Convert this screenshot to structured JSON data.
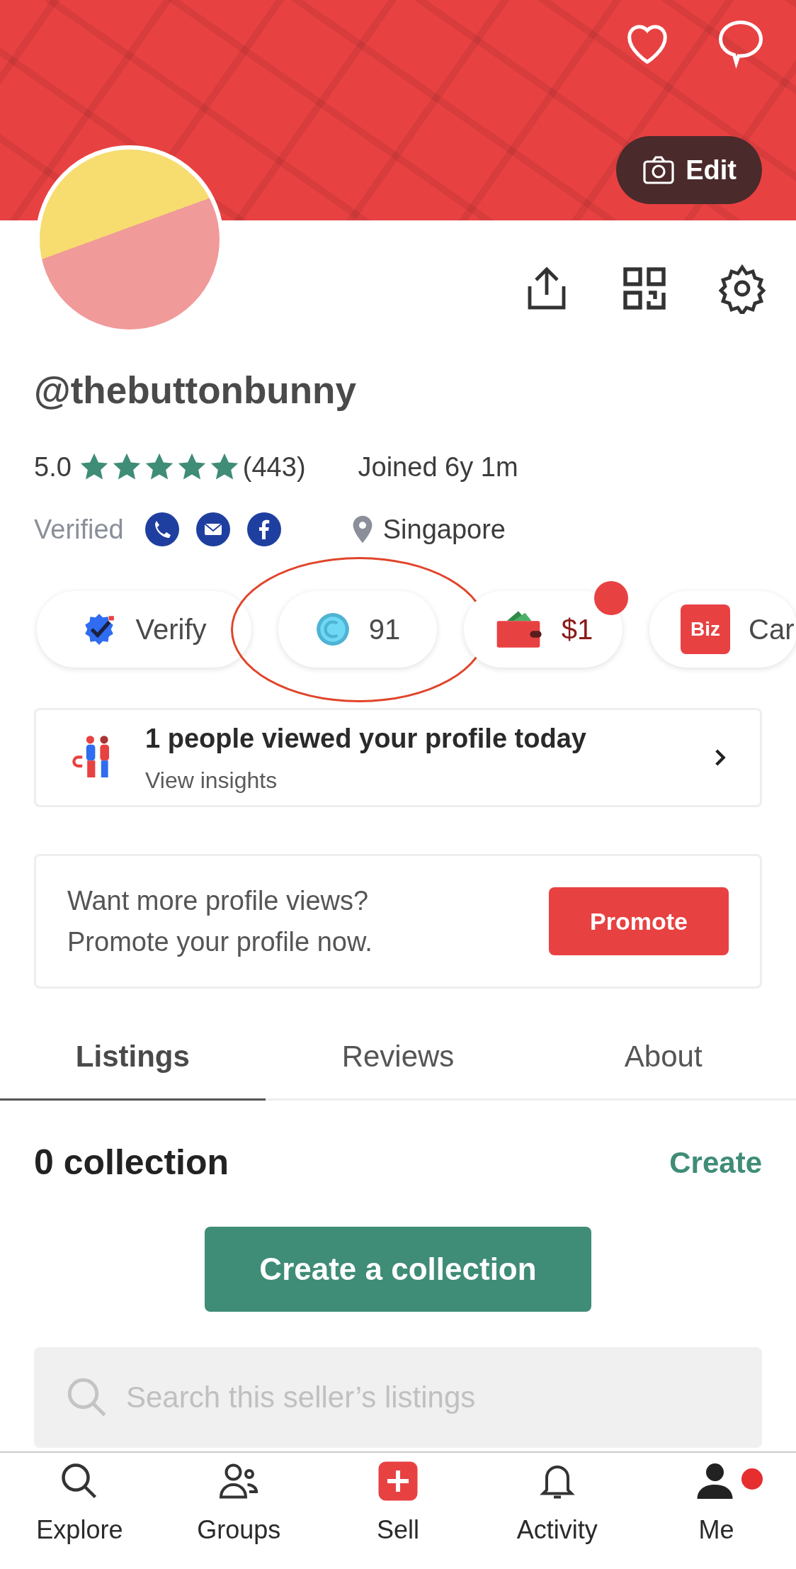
{
  "header": {
    "edit_label": "Edit"
  },
  "profile": {
    "username": "@thebuttonbunny",
    "rating": "5.0",
    "stars": 5,
    "review_count": "(443)",
    "joined": "Joined 6y 1m",
    "verified_label": "Verified",
    "location": "Singapore"
  },
  "chips": [
    {
      "kind": "verify",
      "label": "Verify",
      "dot": false
    },
    {
      "kind": "coins",
      "label": "91",
      "dot": false,
      "highlighted": true
    },
    {
      "kind": "wallet",
      "label": "$1",
      "dot": true
    },
    {
      "kind": "biz",
      "icon_text": "Biz",
      "label": "Car",
      "dot": false
    }
  ],
  "insights": {
    "title": "1 people viewed your profile today",
    "link": "View insights"
  },
  "promo": {
    "line1": "Want more profile views?",
    "line2": "Promote your profile now.",
    "button": "Promote"
  },
  "tabs": [
    {
      "label": "Listings",
      "selected": true
    },
    {
      "label": "Reviews",
      "selected": false
    },
    {
      "label": "About",
      "selected": false
    }
  ],
  "collections": {
    "title": "0 collection",
    "create_link": "Create",
    "create_button": "Create a collection"
  },
  "search": {
    "placeholder": "Search this seller’s listings"
  },
  "nav": [
    {
      "kind": "explore",
      "label": "Explore",
      "dot": false
    },
    {
      "kind": "groups",
      "label": "Groups",
      "dot": false
    },
    {
      "kind": "sell",
      "label": "Sell",
      "dot": false
    },
    {
      "kind": "activity",
      "label": "Activity",
      "dot": false
    },
    {
      "kind": "me",
      "label": "Me",
      "dot": true
    }
  ]
}
